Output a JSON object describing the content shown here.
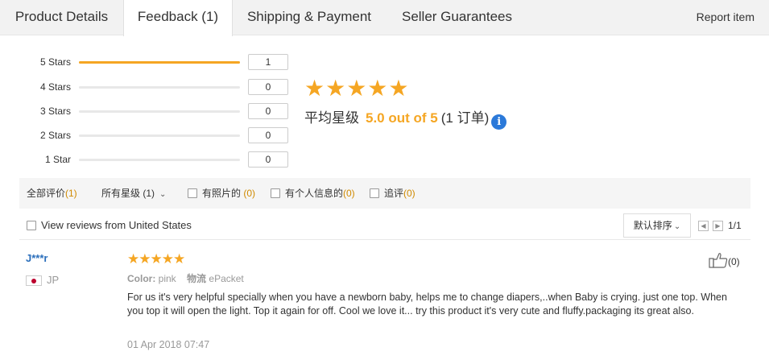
{
  "tabs": [
    {
      "label": "Product Details"
    },
    {
      "label": "Feedback (1)"
    },
    {
      "label": "Shipping & Payment"
    },
    {
      "label": "Seller Guarantees"
    }
  ],
  "report_label": "Report item",
  "histogram": [
    {
      "label": "5 Stars",
      "count": "1",
      "fraction": 1
    },
    {
      "label": "4 Stars",
      "count": "0",
      "fraction": 0
    },
    {
      "label": "3 Stars",
      "count": "0",
      "fraction": 0
    },
    {
      "label": "2 Stars",
      "count": "0",
      "fraction": 0
    },
    {
      "label": "1 Star",
      "count": "0",
      "fraction": 0
    }
  ],
  "summary": {
    "stars": "★★★★★",
    "avg_label": "平均星级",
    "score": "5.0 out of 5",
    "orders": "(1 订单)",
    "info": "i"
  },
  "filters": {
    "all": {
      "label": "全部评价",
      "count": "(1)"
    },
    "stars": {
      "label": "所有星级",
      "count": "(1)"
    },
    "photos": {
      "label": "有照片的",
      "count": "(0)"
    },
    "personal": {
      "label": "有个人信息的",
      "count": "(0)"
    },
    "followup": {
      "label": "追评",
      "count": "(0)"
    }
  },
  "view_us_label": "View reviews from United States",
  "sort_label": "默认排序",
  "pagination": "1/1",
  "review": {
    "name": "J***r",
    "country": "JP",
    "stars": "★★★★★",
    "color_label": "Color:",
    "color_value": "pink",
    "logistics_label": "物流",
    "logistics_value": "ePacket",
    "text": "For us it's very helpful specially when you have a newborn baby, helps me to change diapers,..when Baby is crying. just one top. When you top it will open the light. Top it again for off. Cool we love it... try this product it's very cute and fluffy.packaging its great also.",
    "date": "01 Apr 2018 07:47",
    "helpful_count": "(0)"
  }
}
